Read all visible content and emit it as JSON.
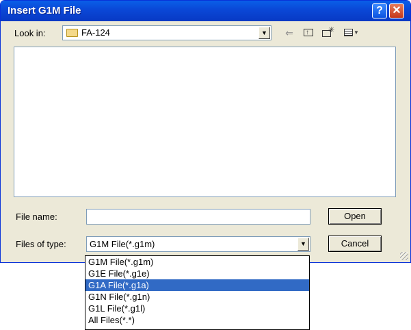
{
  "dialog": {
    "title": "Insert G1M File",
    "help_label": "?",
    "close_label": "✕"
  },
  "look_in": {
    "label": "Look in:",
    "value": "FA-124"
  },
  "toolbar": {
    "back_glyph": "⇐"
  },
  "file_name": {
    "label": "File name:",
    "value": ""
  },
  "file_type": {
    "label": "Files of type:",
    "value": "G1M File(*.g1m)",
    "options": [
      "G1M File(*.g1m)",
      "G1E File(*.g1e)",
      "G1A File(*.g1a)",
      "G1N File(*.g1n)",
      "G1L File(*.g1l)",
      "All Files(*.*)"
    ],
    "highlighted_index": 2
  },
  "buttons": {
    "open": "Open",
    "cancel": "Cancel"
  },
  "colors": {
    "title_bar": "#0a47d6",
    "highlight": "#316ac5",
    "dialog_bg": "#ece9d8"
  }
}
